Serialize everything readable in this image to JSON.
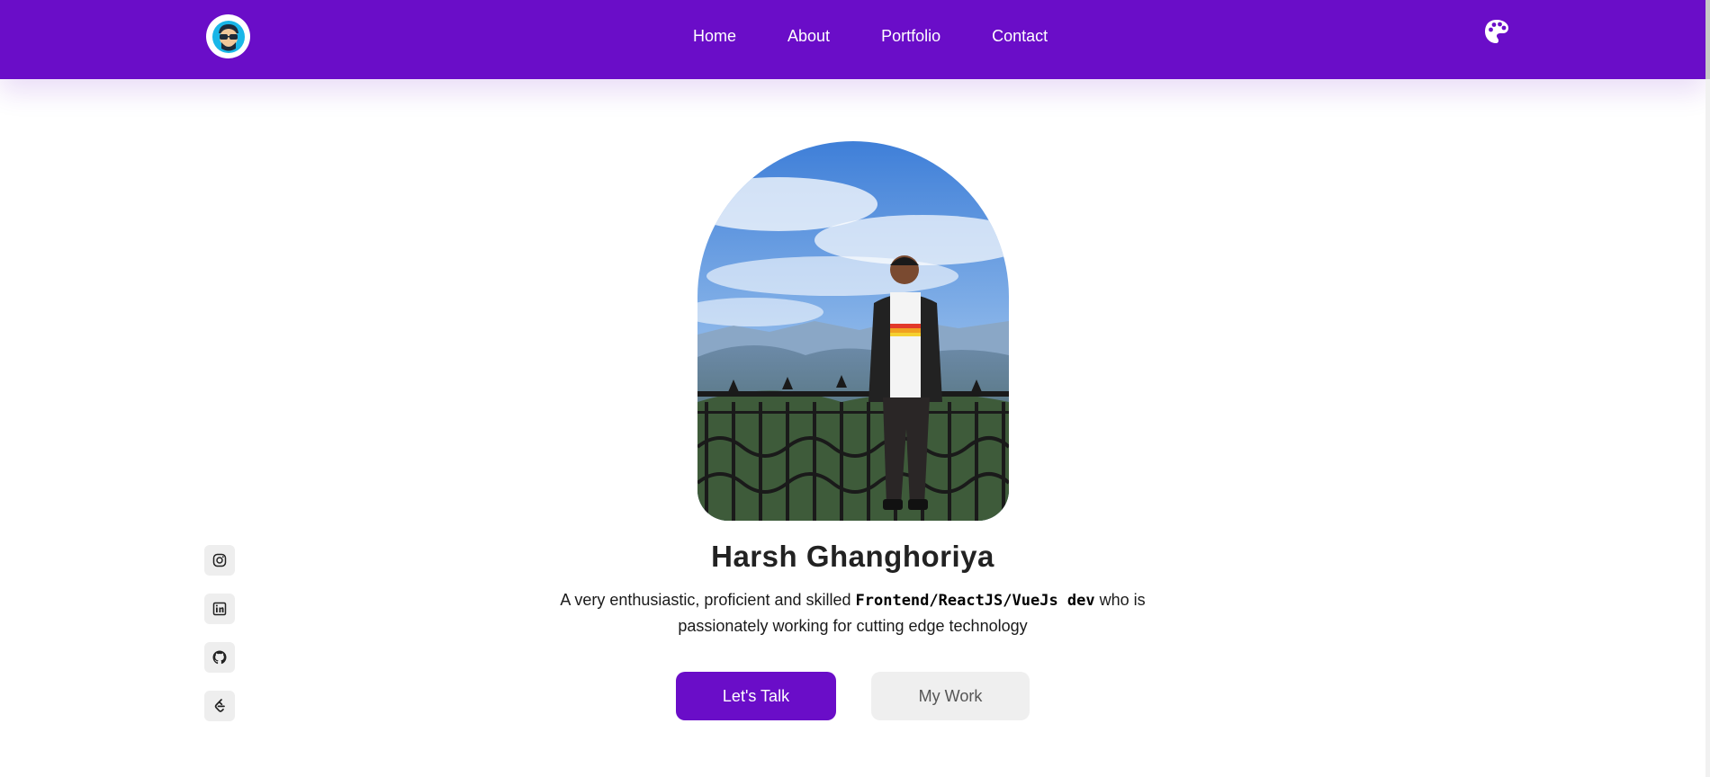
{
  "header": {
    "nav": [
      "Home",
      "About",
      "Portfolio",
      "Contact"
    ]
  },
  "hero": {
    "name": "Harsh Ghanghoriya",
    "intro_pre": "A very enthusiastic, proficient and skilled ",
    "intro_bold": "Frontend/ReactJS/VueJs dev",
    "intro_post": " who is passionately working for cutting edge technology",
    "primary_button": "Let's Talk",
    "secondary_button": "My Work"
  },
  "socials": [
    "instagram-icon",
    "linkedin-icon",
    "github-icon",
    "leetcode-icon"
  ],
  "colors": {
    "brand": "#6a0dc8",
    "secondary_button_bg": "#efefef",
    "text": "#222222"
  }
}
